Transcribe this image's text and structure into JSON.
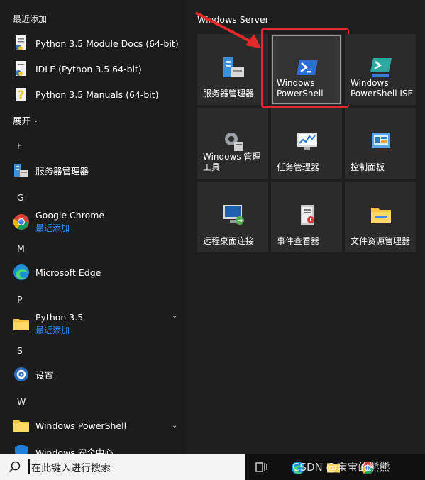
{
  "left": {
    "recent_header": "最近添加",
    "recent": [
      {
        "label": "Python 3.5 Module Docs (64-bit)",
        "icon": "python-docs-icon"
      },
      {
        "label": "IDLE (Python 3.5 64-bit)",
        "icon": "idle-icon"
      },
      {
        "label": "Python 3.5 Manuals (64-bit)",
        "icon": "python-manuals-icon"
      }
    ],
    "expand_label": "展开",
    "letters": {
      "f": "F",
      "g": "G",
      "m": "M",
      "p": "P",
      "s": "S",
      "w": "W"
    },
    "apps": {
      "server_manager": {
        "label": "服务器管理器"
      },
      "chrome": {
        "label": "Google Chrome",
        "sub": "最近添加"
      },
      "edge": {
        "label": "Microsoft Edge"
      },
      "python_folder": {
        "label": "Python 3.5",
        "sub": "最近添加"
      },
      "settings": {
        "label": "设置"
      },
      "powershell_folder": {
        "label": "Windows PowerShell"
      },
      "security": {
        "label": "Windows 安全中心"
      }
    }
  },
  "right": {
    "group_title": "Windows Server",
    "tiles": [
      {
        "label": "服务器管理器"
      },
      {
        "label": "Windows PowerShell"
      },
      {
        "label": "Windows PowerShell ISE"
      },
      {
        "label": "Windows 管理工具"
      },
      {
        "label": "任务管理器"
      },
      {
        "label": "控制面板"
      },
      {
        "label": "远程桌面连接"
      },
      {
        "label": "事件查看器"
      },
      {
        "label": "文件资源管理器"
      }
    ]
  },
  "taskbar": {
    "search_placeholder": "在此键入进行搜索",
    "watermark": "CSDN @宝宝的熊熊"
  },
  "colors": {
    "accent_blue": "#2f8fff",
    "highlight_red": "#e32a2a",
    "tile_bg": "#2b2b2b"
  }
}
